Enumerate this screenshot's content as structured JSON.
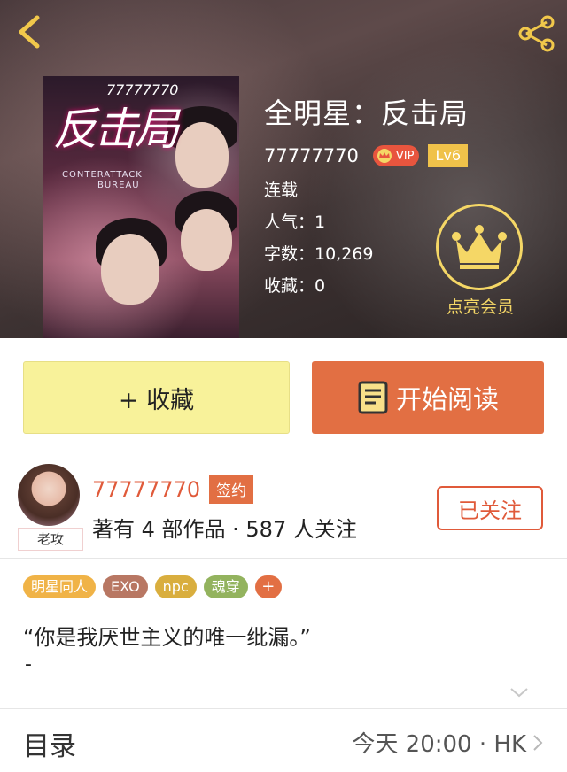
{
  "header": {
    "back_icon": "chevron-left-icon",
    "share_icon": "share-icon"
  },
  "cover": {
    "title_art": "反击局",
    "number": "77777770",
    "subtitle_line1": "CONTERATTACK",
    "subtitle_line2": "BUREAU"
  },
  "book": {
    "title": "全明星：反击局",
    "author": "77777770",
    "vip_label": "VIP",
    "level": "Lv6",
    "status": "连载",
    "popularity": "人气：1",
    "word_count": "字数：10,269",
    "favorites": "收藏：0"
  },
  "member": {
    "label": "点亮会员",
    "icon": "crown-icon",
    "color": "#f5d766"
  },
  "actions": {
    "favorite_label": "+ 收藏",
    "read_label": "开始阅读",
    "favorite_color": "#f8f29a",
    "read_color": "#e26f43"
  },
  "author_card": {
    "avatar_tag": "老攻",
    "name": "77777770",
    "sign_badge": "签约",
    "description": "著有 4 部作品 · 587 人关注",
    "follow_label": "已关注"
  },
  "tags": [
    {
      "label": "明星同人",
      "color": "#f0b347"
    },
    {
      "label": "EXO",
      "color": "#b87763"
    },
    {
      "label": "npc",
      "color": "#d9ae3e"
    },
    {
      "label": "魂穿",
      "color": "#93b35e"
    }
  ],
  "tag_add_label": "+",
  "intro": {
    "quote": "“你是我厌世主义的唯一纰漏。”",
    "dash": "-"
  },
  "toc": {
    "label": "目录",
    "update": "今天 20:00 · HK"
  }
}
